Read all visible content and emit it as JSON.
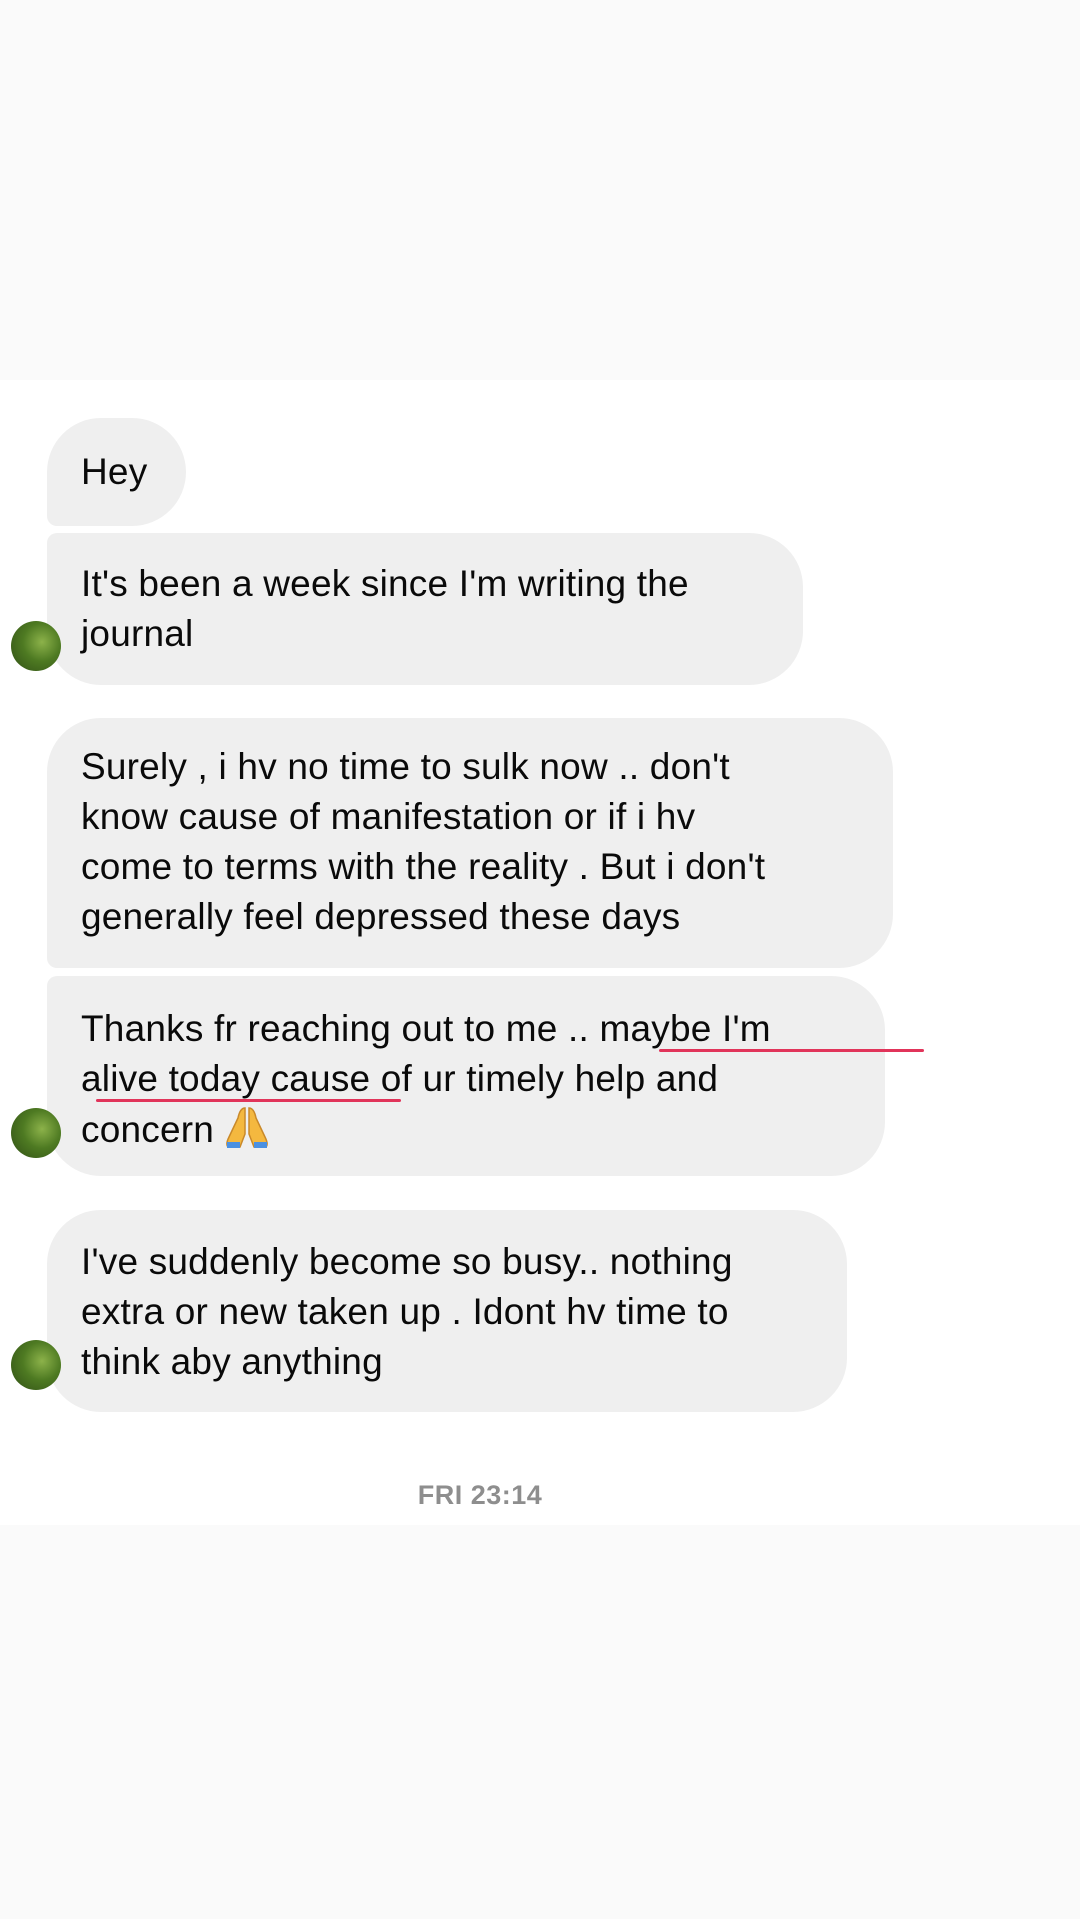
{
  "messages": [
    {
      "text": "Hey"
    },
    {
      "lines": [
        "It's been a week since I'm writing the",
        "journal"
      ]
    },
    {
      "lines": [
        "Surely , i hv no time to sulk now .. don't",
        "know cause of manifestation or if i hv",
        "come to terms with the reality . But i don't",
        "generally feel depressed these days"
      ]
    },
    {
      "lines": [
        "Thanks fr reaching out to me .. maybe I'm",
        "alive today cause of ur timely help and",
        "concern"
      ],
      "emoji": "folded-hands-icon"
    },
    {
      "lines": [
        "I've suddenly become so busy.. nothing",
        "extra or new taken up . Idont hv time to",
        "think aby anything"
      ]
    }
  ],
  "timestamp": "FRI 23:14",
  "colors": {
    "bubble": "#efefef",
    "highlight_underline": "#e1345a",
    "timestamp": "#8e8e8e"
  }
}
